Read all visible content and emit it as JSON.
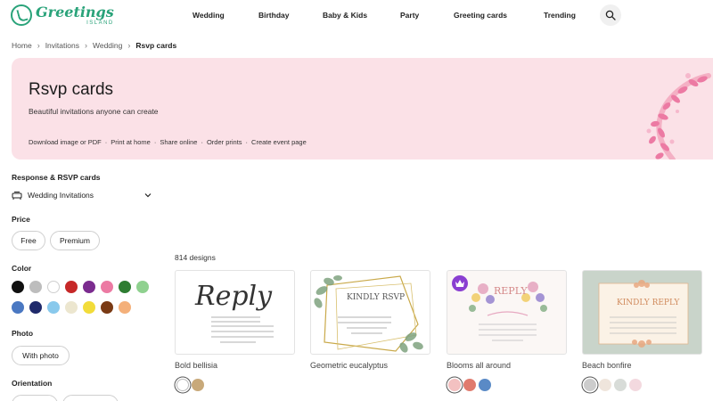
{
  "brand": {
    "name": "Greetings",
    "sub": "ISLAND",
    "color": "#2aa37a"
  },
  "nav": [
    "Wedding",
    "Birthday",
    "Baby & Kids",
    "Party",
    "Greeting cards",
    "Trending"
  ],
  "breadcrumb": [
    "Home",
    "Invitations",
    "Wedding",
    "Rsvp cards"
  ],
  "hero": {
    "title": "Rsvp cards",
    "subtitle": "Beautiful invitations anyone can create",
    "features": [
      "Download image or PDF",
      "Print at home",
      "Share online",
      "Order prints",
      "Create event page"
    ],
    "background": "#fbe1e7"
  },
  "sidebar": {
    "category_heading": "Response & RSVP cards",
    "category_select": "Wedding Invitations",
    "price_heading": "Price",
    "price_options": [
      "Free",
      "Premium"
    ],
    "color_heading": "Color",
    "colors": [
      "#111111",
      "#bdbdbd",
      "#ffffff",
      "#c62828",
      "#7b2c8f",
      "#ec7aa3",
      "#2e7d32",
      "#8fd18f",
      "#4a78c2",
      "#1f2a6b",
      "#89c9ec",
      "#ece6cf",
      "#f2dc3a",
      "#7a3a14",
      "#f4b07a"
    ],
    "photo_heading": "Photo",
    "photo_option": "With photo",
    "orientation_heading": "Orientation"
  },
  "results": {
    "count": "814 designs",
    "cards": [
      {
        "name": "Bold bellisia",
        "options": [
          "#ffffff",
          "#c8a97a"
        ],
        "selected": 0,
        "premium": false
      },
      {
        "name": "Geometric eucalyptus",
        "options": [],
        "selected": -1,
        "premium": false
      },
      {
        "name": "Blooms all around",
        "options": [
          "#f3c1c1",
          "#e07b6e",
          "#5a8ac6"
        ],
        "selected": 0,
        "premium": true
      },
      {
        "name": "Beach bonfire",
        "options": [
          "#cccccc",
          "#efe5dc",
          "#d8dcd8",
          "#f3d9df"
        ],
        "selected": 0,
        "premium": false
      }
    ]
  },
  "card_text": {
    "reply_script": "Reply",
    "kindly_rsvp": "KINDLY RSVP",
    "reply_caps": "REPLY",
    "kindly_reply": "KINDLY REPLY"
  }
}
